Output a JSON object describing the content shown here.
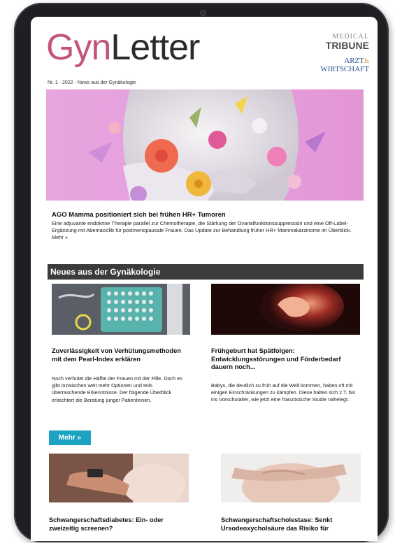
{
  "header": {
    "brand_part1": "Gyn",
    "brand_part2": "Letter",
    "issue_line": "Nr. 1 - 2022 - News aus der Gynäkologie",
    "partner1_line1": "MEDICAL",
    "partner1_line2": "TRIBUNE",
    "partner2_line1": "ARZT",
    "partner2_amp": "&",
    "partner2_line2": "WIRTSCHAFT"
  },
  "feature": {
    "title": "AGO Mamma positioniert sich bei frühen HR+ Tumoren",
    "text": "Eine adjuvante endokrine Therapie parallel zur Chemotherapie, die Stärkung der Ovarialfunktionssuppression und eine Off-Label-Ergänzung mit Abemaciclib für postmenopausale Frauen. Das Update zur Behandlung früher HR+ Mammakarzinome im Überblick. Mehr »"
  },
  "section": {
    "title": "Neues aus der Gynäkologie"
  },
  "articles": [
    {
      "title": "Zuverlässigkeit von Verhütungsmethoden mit dem Pearl-Index erklären",
      "text": "Noch verhütet die Hälfte der Frauen mit der Pille. Doch es gibt inzwischen weit mehr Optionen und teils überraschende Erkenntnisse. Der folgende Überblick erleichtert die Beratung junger Patientinnen."
    },
    {
      "title": "Frühgeburt hat Spätfolgen: Entwicklungsstörungen und Förderbedarf dauern noch...",
      "text": "Babys, die deutlich zu früh auf die Welt kommen, haben oft mit einigen Einschränkungen zu kämpfen. Diese halten sich z.T. bis ins Vorschulalter, wie jetzt eine französische Studie nahelegt."
    }
  ],
  "more_button": "Mehr »",
  "bottom_articles": [
    {
      "title": "Schwangerschaftsdiabetes: Ein- oder zweizeitig screenen?"
    },
    {
      "title": "Schwangerschaftscholestase: Senkt Ursodeoxycholsäure das Risiko für"
    }
  ],
  "colors": {
    "brand_pink": "#c2557a",
    "section_bar": "#3b3b3b",
    "button": "#1ba3c1",
    "hero_bg": "#e6a3dd"
  }
}
